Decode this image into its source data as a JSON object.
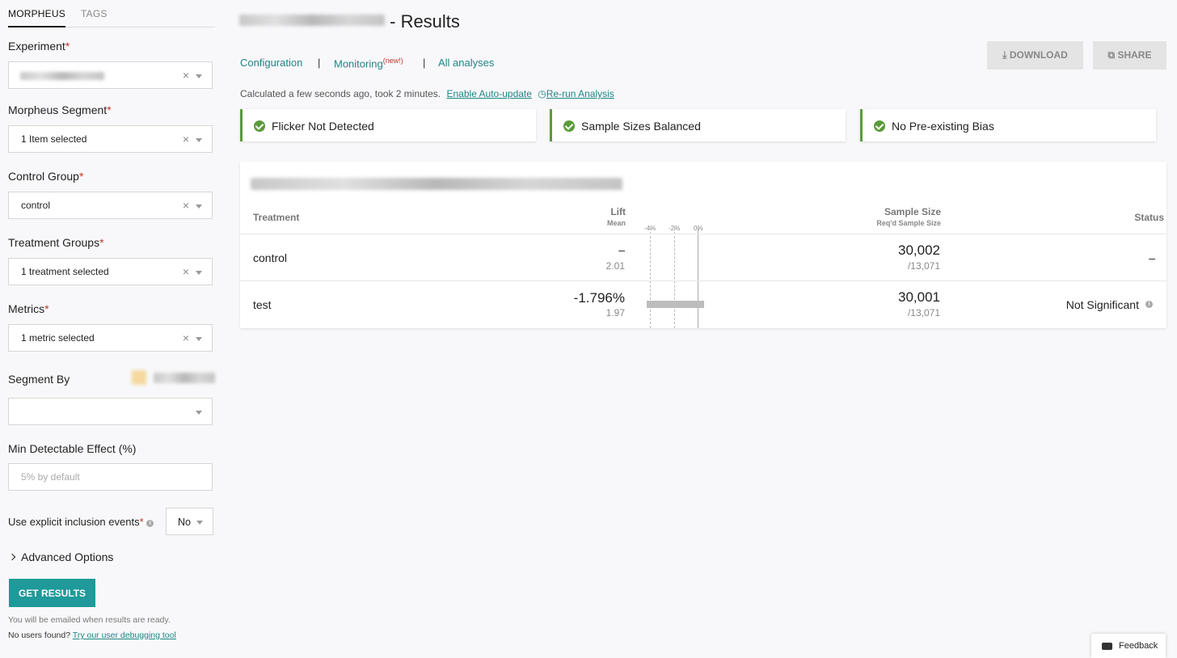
{
  "sidebar": {
    "tabs": [
      "MORPHEUS",
      "TAGS"
    ],
    "experiment": {
      "label": "Experiment",
      "required": "*"
    },
    "segment": {
      "label": "Morpheus Segment",
      "required": "*",
      "value": "1 Item selected"
    },
    "control_group": {
      "label": "Control Group",
      "required": "*",
      "value": "control"
    },
    "treatment_groups": {
      "label": "Treatment Groups",
      "required": "*",
      "value": "1 treatment selected"
    },
    "metrics": {
      "label": "Metrics",
      "required": "*",
      "value": "1 metric selected"
    },
    "segment_by": {
      "label": "Segment By"
    },
    "mde": {
      "label": "Min Detectable Effect (%)",
      "placeholder": "5% by default"
    },
    "inclusion": {
      "label": "Use explicit inclusion events",
      "required": "*",
      "value": "No"
    },
    "advanced": "Advanced Options",
    "get_results": "GET RESULTS",
    "email_note": "You will be emailed when results are ready.",
    "no_users": "No users found?",
    "debug_link": "Try our user debugging tool",
    "clear_glyph": "×"
  },
  "header": {
    "title_suffix": "- Results",
    "nav": [
      "Configuration",
      "Monitoring",
      "All analyses"
    ],
    "nav_badge": "(new!)",
    "separator": "|",
    "download": "DOWNLOAD",
    "share": "SHARE",
    "calc_text": "Calculated a few seconds ago, took 2 minutes.",
    "auto_update": "Enable Auto-update",
    "rerun": "Re-run Analysis"
  },
  "checks": [
    "Flicker Not Detected",
    "Sample Sizes Balanced",
    "No Pre-existing Bias"
  ],
  "table": {
    "headers": {
      "treatment": "Treatment",
      "lift": "Lift",
      "lift_sub": "Mean",
      "sample": "Sample Size",
      "sample_sub": "Req'd Sample Size",
      "status": "Status"
    },
    "ticks": [
      "-4%",
      "-2%",
      "0%"
    ],
    "rows": [
      {
        "treatment": "control",
        "lift": "–",
        "mean": "2.01",
        "sample": "30,002",
        "required": "/13,071",
        "status": "–"
      },
      {
        "treatment": "test",
        "lift": "-1.796%",
        "mean": "1.97",
        "sample": "30,001",
        "required": "/13,071",
        "status": "Not Significant"
      }
    ],
    "ci_bar": {
      "low_pct": -4.2,
      "high_pct": 0.5
    }
  },
  "feedback": "Feedback",
  "colors": {
    "accent": "#1f9999",
    "success": "#5a9a3a",
    "required": "#c0392b"
  }
}
